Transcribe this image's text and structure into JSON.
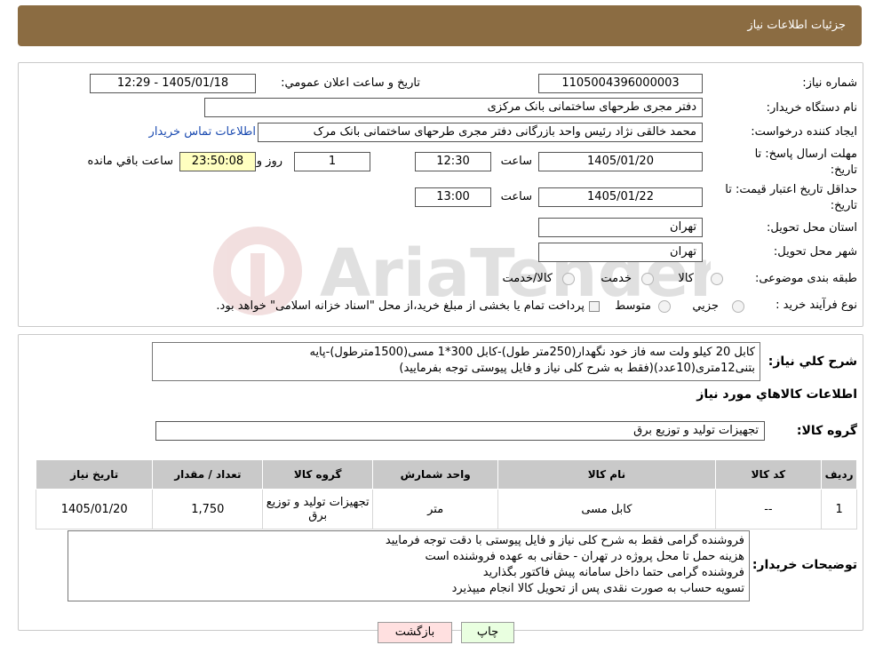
{
  "header": {
    "title": "جزئیات اطلاعات نیاز"
  },
  "form": {
    "need_number": {
      "label": "شماره نیاز:",
      "value": "1105004396000003"
    },
    "announce_datetime": {
      "label": "تاریخ و ساعت اعلان عمومي:",
      "value": "1405/01/18 - 12:29"
    },
    "buyer_org": {
      "label": "نام دستگاه خريدار:",
      "value": "دفتر مجری طرحهای ساختمانی بانک مرکزی"
    },
    "requester": {
      "label": "ايجاد کننده درخواست:",
      "value": "محمد خالقی نژاد رئیس واحد بازرگانی دفتر مجری طرحهای ساختمانی بانک مرک",
      "contact_link": "اطلاعات تماس خريدار"
    },
    "reply_deadline": {
      "label_line1": "مهلت ارسال پاسخ: تا",
      "label_line2": "تاريخ:",
      "date": "1405/01/20",
      "time_label": "ساعت",
      "time": "12:30",
      "days": "1",
      "days_label": "روز و",
      "remaining": "23:50:08",
      "remaining_label": "ساعت باقي مانده"
    },
    "price_validity": {
      "label_line1": "حداقل تاريخ اعتبار قيمت: تا",
      "label_line2": "تاريخ:",
      "date": "1405/01/22",
      "time_label": "ساعت",
      "time": "13:00"
    },
    "province": {
      "label": "استان محل تحويل:",
      "value": "تهران"
    },
    "city": {
      "label": "شهر محل تحويل:",
      "value": "تهران"
    },
    "category": {
      "label": "طبقه بندی موضوعی:",
      "options": [
        "کالا",
        "خدمت",
        "کالا/خدمت"
      ]
    },
    "purchase_type": {
      "label": "نوع فرآيند خريد :",
      "options": [
        "جزيي",
        "متوسط"
      ],
      "note": "پرداخت تمام يا بخشی از مبلغ خريد،از محل \"اسناد خزانه اسلامی\" خواهد بود."
    }
  },
  "description": {
    "label": "شرح کلي نياز:",
    "line1": "کابل 20 کیلو ولت سه فاز خود نگهدار(250متر طول)-کابل 300*1 مسی(1500مترطول)-پایه",
    "line2": "بتنی12متری(10عدد)(فقط به شرح کلی نیاز و فایل پیوستی توجه بفرمایید)"
  },
  "items_section": {
    "title": "اطلاعات کالاهاي مورد نياز",
    "group_label": "گروه کالا:",
    "group_value": "تجهیزات تولید و توزیع برق",
    "columns": [
      "رديف",
      "کد کالا",
      "نام کالا",
      "واحد شمارش",
      "گروه کالا",
      "تعداد / مقدار",
      "تاريخ نياز"
    ],
    "rows": [
      {
        "row": "1",
        "code": "--",
        "name": "کابل مسی",
        "unit": "متر",
        "group": "تجهیزات تولید و توزیع برق",
        "qty": "1,750",
        "date": "1405/01/20"
      }
    ]
  },
  "buyer_notes": {
    "label": "توضيحات خريدار:",
    "lines": [
      "فروشنده گرامی فقط به شرح کلی نیاز و فایل پیوستی با دقت توجه فرمایید",
      "هزینه حمل تا محل پروژه در تهران - حقانی به عهده فروشنده است",
      "فروشنده گرامی حتما داخل سامانه پیش فاکتور بگذارید",
      "تسویه حساب به صورت نقدی پس از تحویل کالا  انجام میپذیرد"
    ]
  },
  "buttons": {
    "print": "چاپ",
    "back": "بازگشت"
  },
  "watermark": {
    "text": "AriaTender.neT"
  },
  "colors": {
    "header_bg": "#8b6c42",
    "print_bg": "#e9ffe0",
    "back_bg": "#ffe0e0",
    "remaining_bg": "#ffffc0",
    "link": "#1a4ab0"
  }
}
